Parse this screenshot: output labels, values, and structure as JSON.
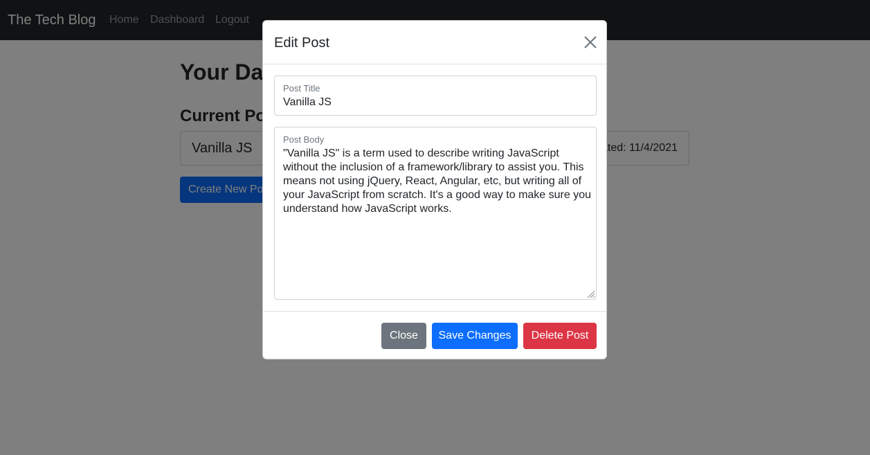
{
  "navbar": {
    "brand": "The Tech Blog",
    "links": [
      "Home",
      "Dashboard",
      "Logout"
    ]
  },
  "page": {
    "title": "Your Dashboard",
    "section_title": "Current Posts",
    "posts": [
      {
        "title": "Vanilla JS",
        "date": "Created: 11/4/2021"
      }
    ],
    "create_button": "Create New Post"
  },
  "modal": {
    "title": "Edit Post",
    "close_icon": "close-icon",
    "title_field": {
      "label": "Post Title",
      "value": "Vanilla JS"
    },
    "body_field": {
      "label": "Post Body",
      "value": "\"Vanilla JS\" is a term used to describe writing JavaScript without the inclusion of a framework/library to assist you. This means not using jQuery, React, Angular, etc, but writing all of your JavaScript from scratch. It's a good way to make sure you understand how JavaScript works."
    },
    "buttons": {
      "close": "Close",
      "save": "Save Changes",
      "delete": "Delete Post"
    }
  },
  "colors": {
    "navbar": "#212529",
    "primary": "#0d6efd",
    "secondary": "#6c757d",
    "danger": "#dc3545"
  }
}
